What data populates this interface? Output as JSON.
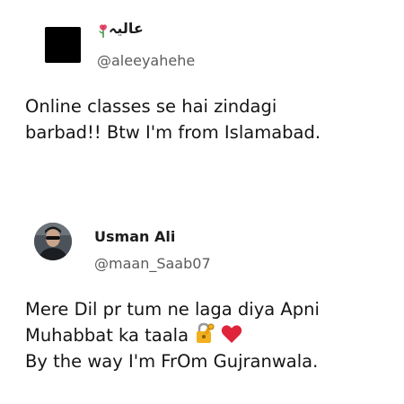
{
  "tweets": [
    {
      "display_name": "عالیہ",
      "name_emoji": "flower-icon",
      "handle": "@aleeyahehe",
      "text_lines": [
        "Online classes se hai zindagi",
        "barbad!! Btw I'm from Islamabad."
      ]
    },
    {
      "display_name": "Usman Ali",
      "handle": "@maan_Saab07",
      "text_lines": [
        "Mere Dil pr tum ne laga diya Apni",
        "Muhabbat ka taala",
        "By the way I'm FrOm Gujranwala."
      ],
      "line_emojis": [
        "lock-with-key-icon",
        "red-heart-icon"
      ]
    }
  ],
  "colors": {
    "background": "#ffffff",
    "text": "#151515",
    "handle": "#5b5b5b",
    "heart": "#e0243a",
    "lock": "#f2b01e"
  }
}
